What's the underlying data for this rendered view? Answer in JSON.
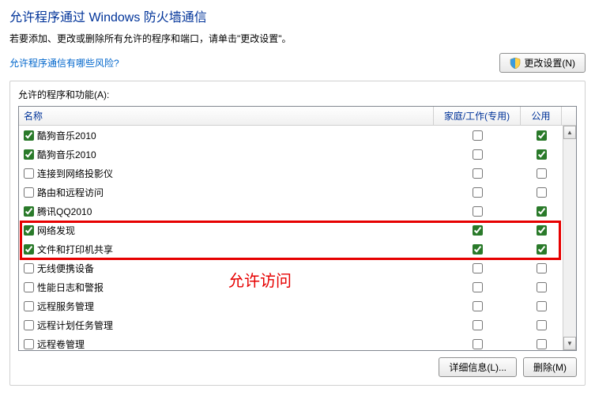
{
  "title": "允许程序通过 Windows 防火墙通信",
  "subtitle": "若要添加、更改或删除所有允许的程序和端口，请单击\"更改设置\"。",
  "risk_link": "允许程序通信有哪些风险?",
  "change_settings_btn": "更改设置(N)",
  "panel_label": "允许的程序和功能(A):",
  "columns": {
    "name": "名称",
    "home": "家庭/工作(专用)",
    "public": "公用"
  },
  "rows": [
    {
      "enabled": true,
      "name": "酷狗音乐2010",
      "home": false,
      "public": true
    },
    {
      "enabled": true,
      "name": "酷狗音乐2010",
      "home": false,
      "public": true
    },
    {
      "enabled": false,
      "name": "连接到网络投影仪",
      "home": false,
      "public": false
    },
    {
      "enabled": false,
      "name": "路由和远程访问",
      "home": false,
      "public": false
    },
    {
      "enabled": true,
      "name": "腾讯QQ2010",
      "home": false,
      "public": true
    },
    {
      "enabled": true,
      "name": "网络发现",
      "home": true,
      "public": true
    },
    {
      "enabled": true,
      "name": "文件和打印机共享",
      "home": true,
      "public": true
    },
    {
      "enabled": false,
      "name": "无线便携设备",
      "home": false,
      "public": false
    },
    {
      "enabled": false,
      "name": "性能日志和警报",
      "home": false,
      "public": false
    },
    {
      "enabled": false,
      "name": "远程服务管理",
      "home": false,
      "public": false
    },
    {
      "enabled": false,
      "name": "远程计划任务管理",
      "home": false,
      "public": false
    },
    {
      "enabled": false,
      "name": "远程卷管理",
      "home": false,
      "public": false
    }
  ],
  "annotation": "允许访问",
  "details_btn": "详细信息(L)...",
  "delete_btn": "删除(M)"
}
